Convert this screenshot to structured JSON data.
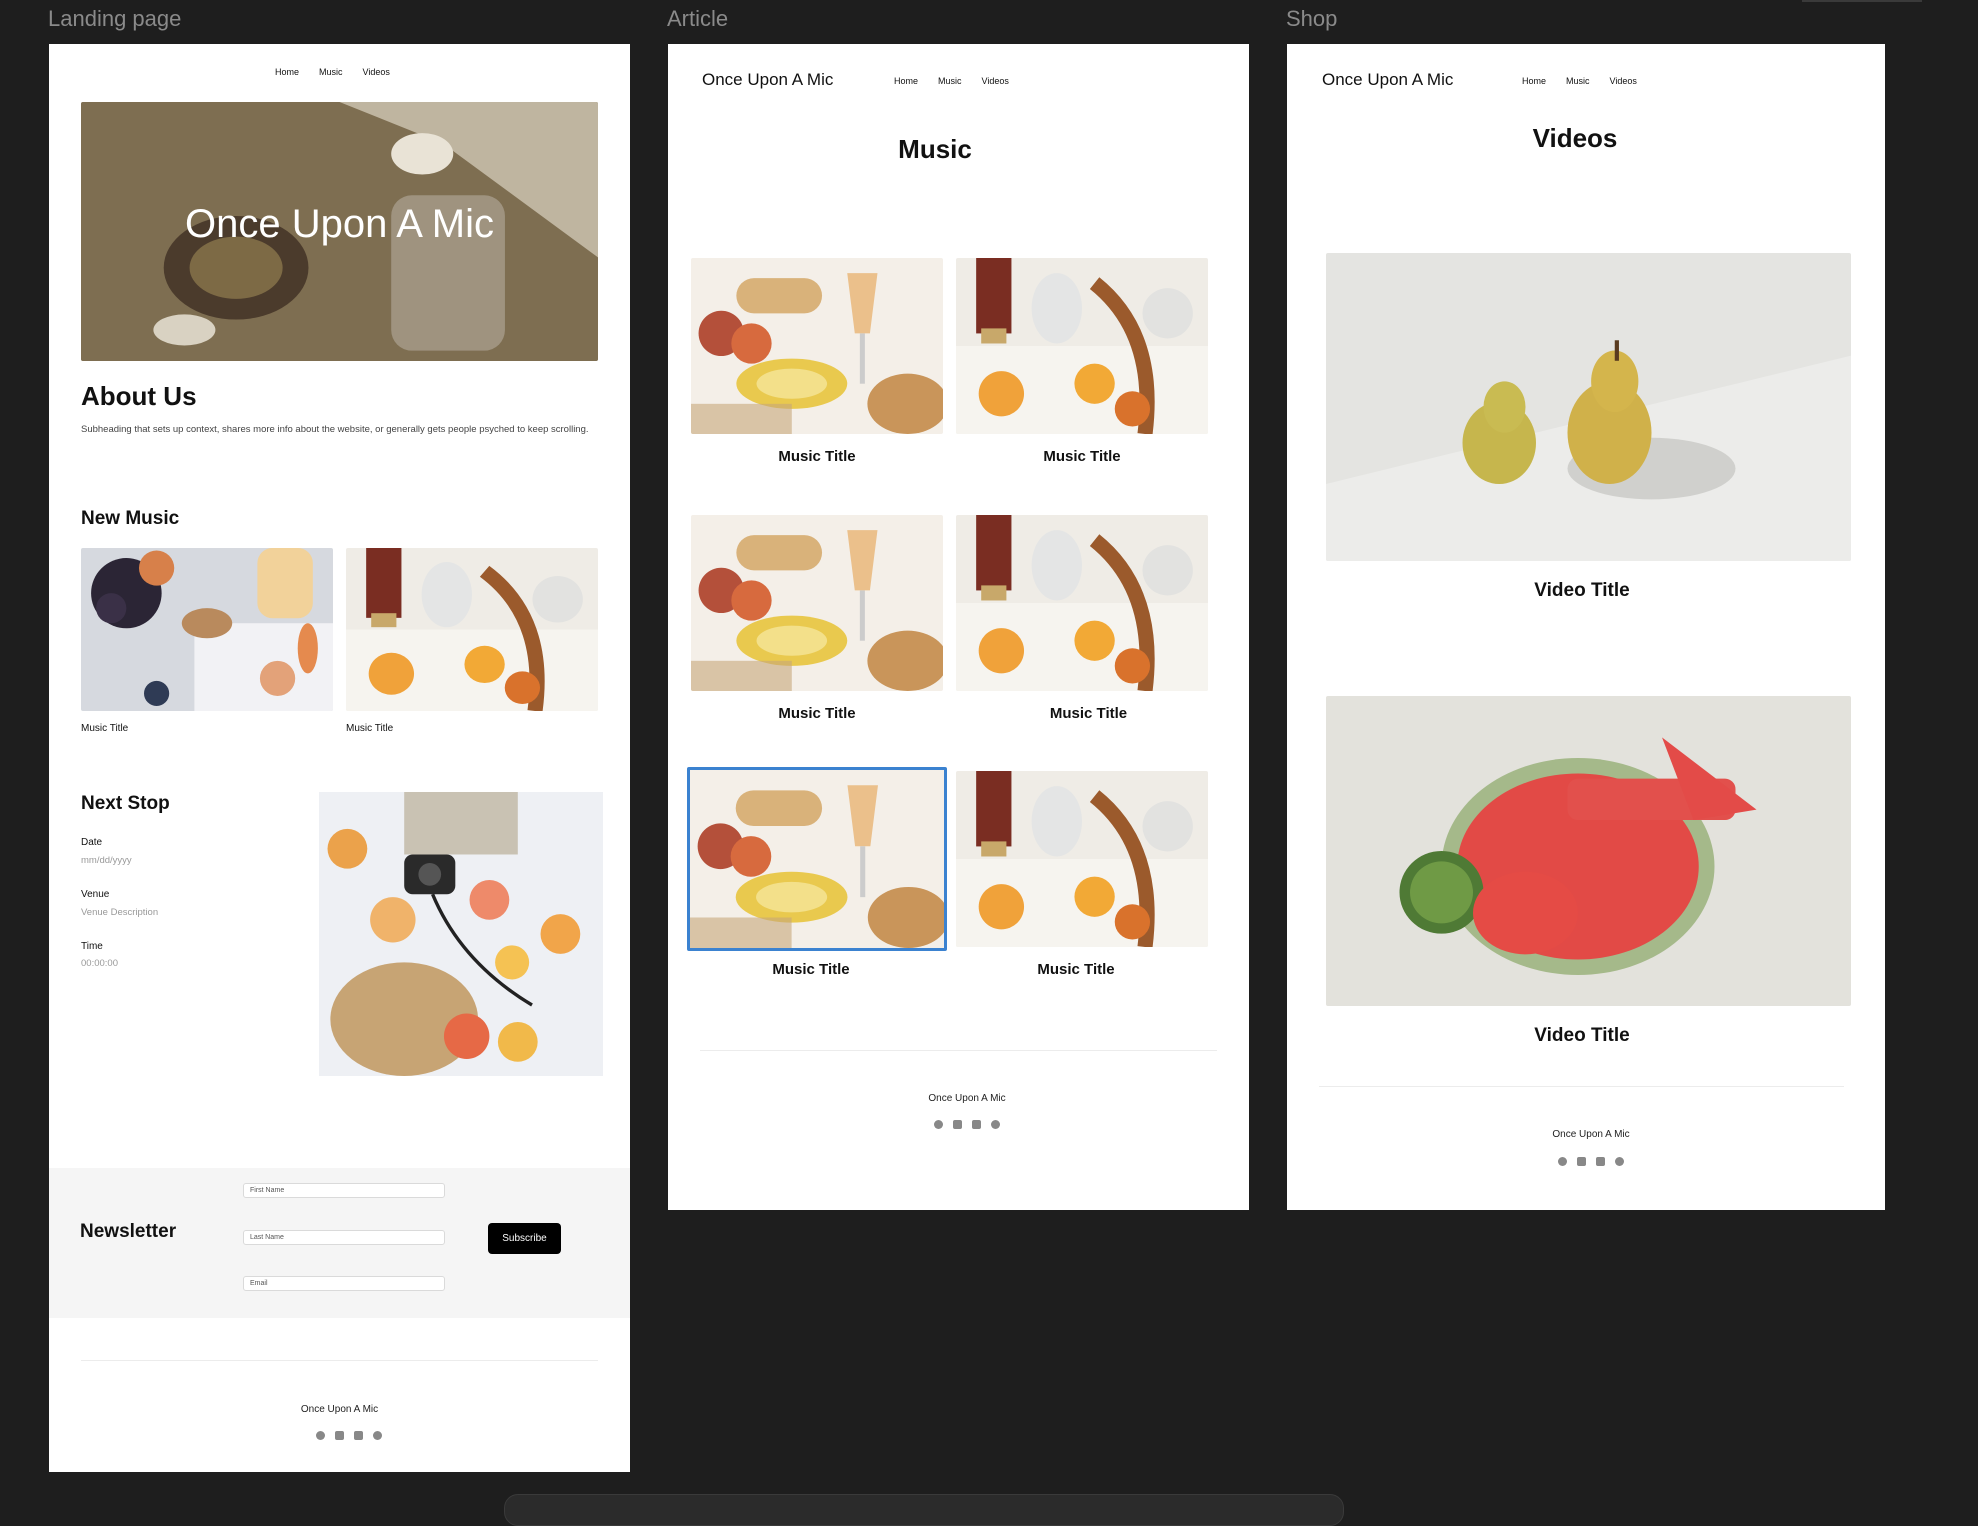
{
  "canvas": {
    "labels": [
      "Landing page",
      "Article",
      "Shop"
    ]
  },
  "nav": {
    "home": "Home",
    "music": "Music",
    "videos": "Videos"
  },
  "brand": "Once Upon A Mic",
  "landing": {
    "hero_title": "Once Upon A Mic",
    "about_heading": "About Us",
    "about_text": "Subheading that sets up context, shares more info about the website, or generally gets people psyched to keep scrolling.",
    "new_music_heading": "New Music",
    "music_items": [
      "Music Title",
      "Music Title"
    ],
    "next_stop": {
      "heading": "Next Stop",
      "date_label": "Date",
      "date_value": "mm/dd/yyyy",
      "venue_label": "Venue",
      "venue_value": "Venue Description",
      "time_label": "Time",
      "time_value": "00:00:00"
    },
    "newsletter": {
      "heading": "Newsletter",
      "first_name_placeholder": "First Name",
      "last_name_placeholder": "Last Name",
      "email_placeholder": "Email",
      "subscribe_label": "Subscribe"
    },
    "footer_brand": "Once Upon A Mic"
  },
  "article": {
    "brand": "Once Upon A Mic",
    "title": "Music",
    "items": [
      "Music Title",
      "Music Title",
      "Music Title",
      "Music Title",
      "Music Title",
      "Music Title"
    ],
    "selected_index": 4,
    "footer_brand": "Once Upon A Mic"
  },
  "shop": {
    "brand": "Once Upon A Mic",
    "title": "Videos",
    "items": [
      "Video Title",
      "Video Title"
    ],
    "footer_brand": "Once Upon A Mic"
  },
  "social_icons": [
    "facebook-icon",
    "linkedin-icon",
    "youtube-icon",
    "instagram-icon"
  ],
  "colors": {
    "canvas": "#1e1e1e",
    "selection": "#3b82d0",
    "button": "#000000"
  }
}
